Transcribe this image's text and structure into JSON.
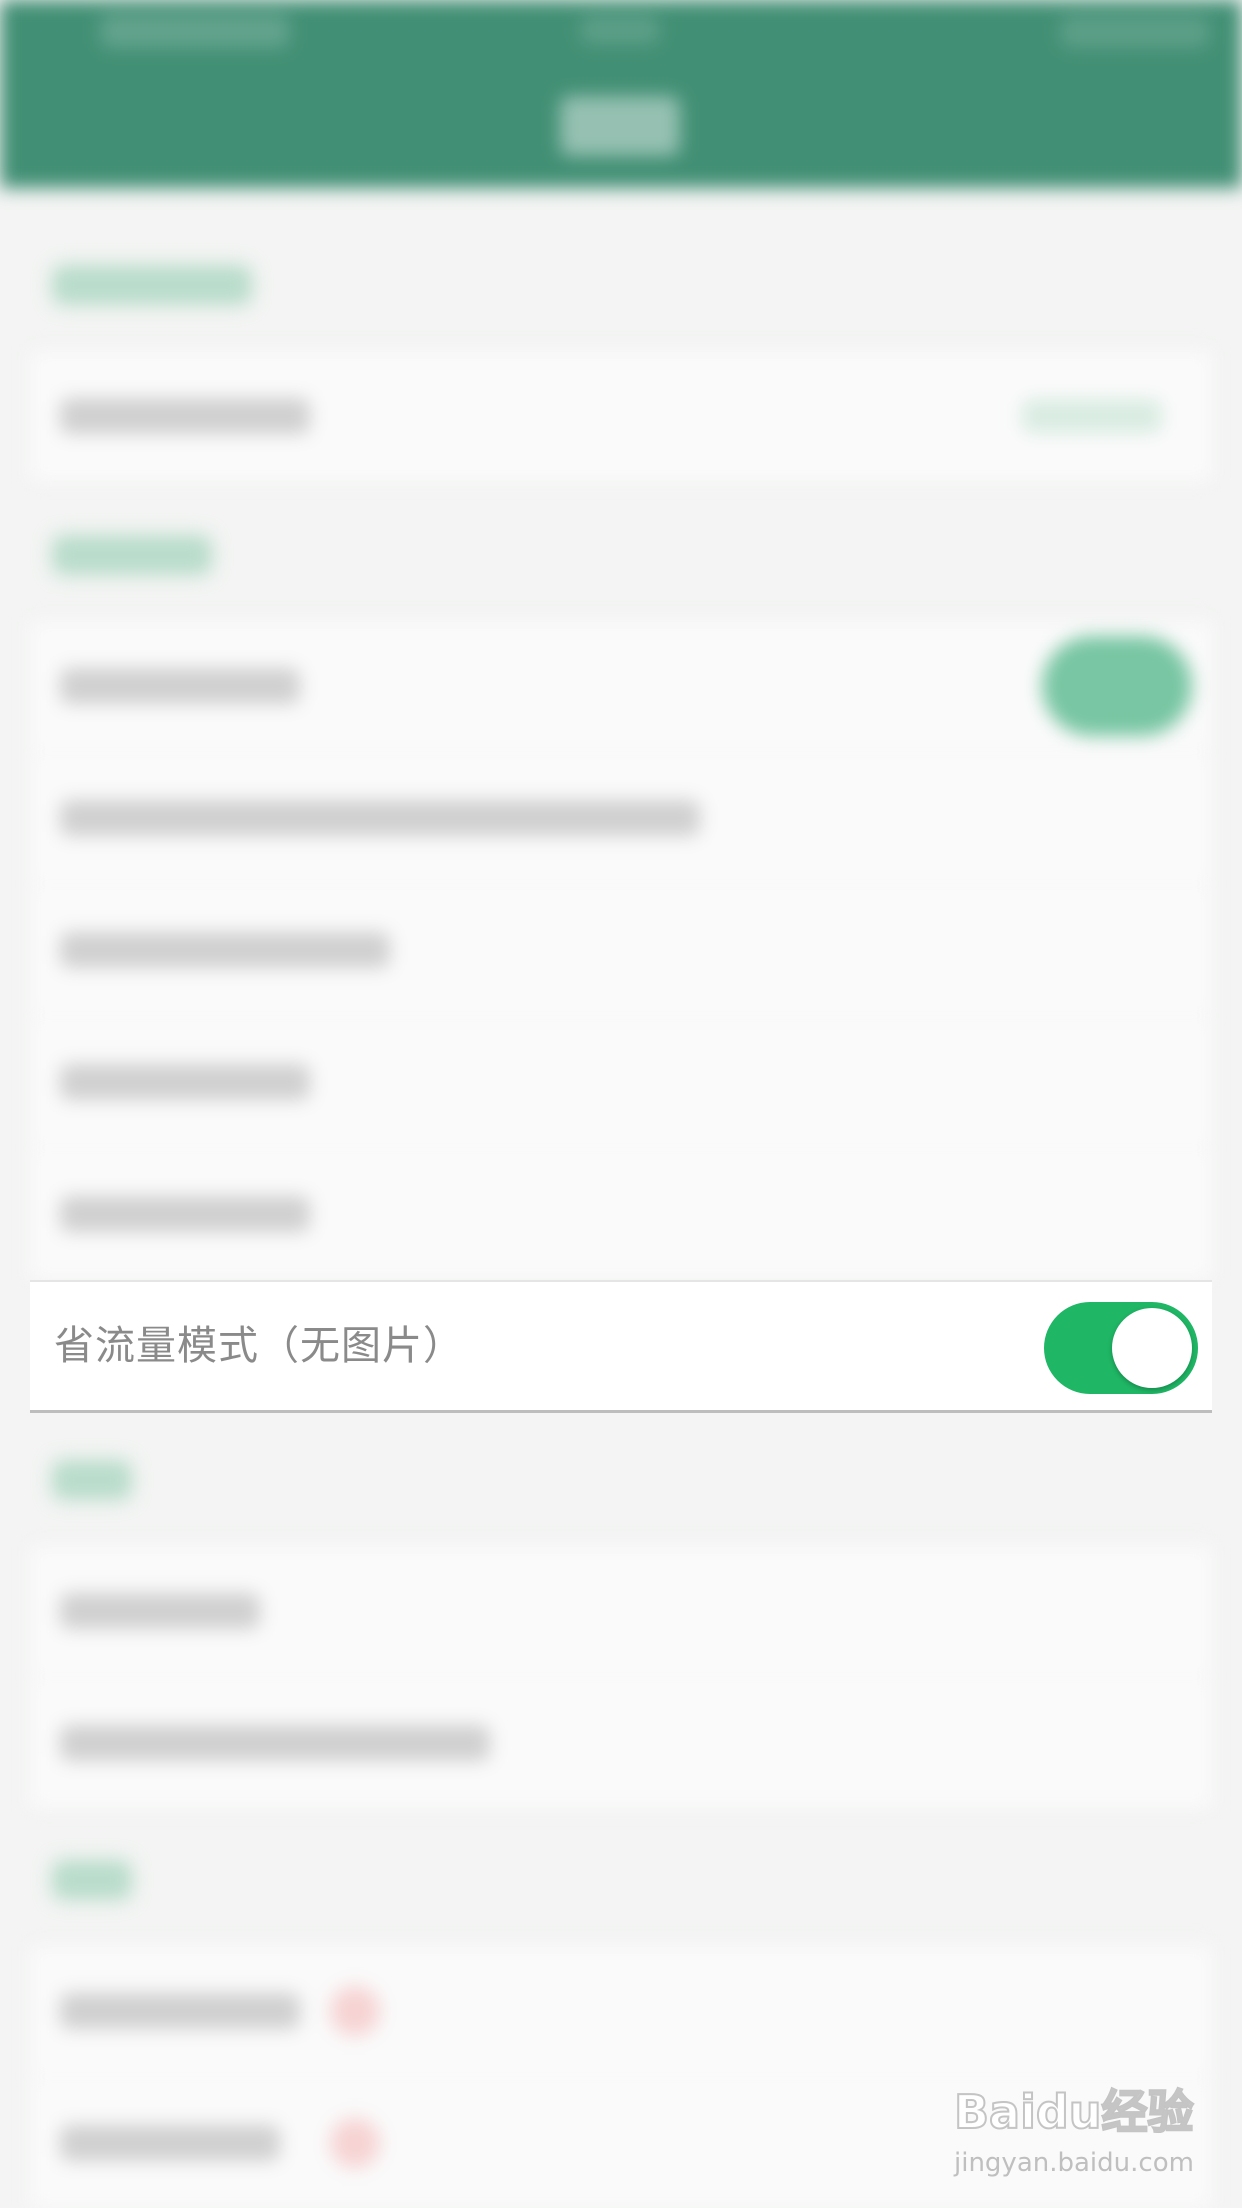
{
  "setting": {
    "label": "省流量模式（无图片）",
    "toggle_on": true
  },
  "watermark": {
    "logo": "Baidu经验",
    "url": "jingyan.baidu.com"
  },
  "colors": {
    "header": "#418f74",
    "toggle_on": "#1fb665",
    "label_text": "#8a8a8a"
  }
}
